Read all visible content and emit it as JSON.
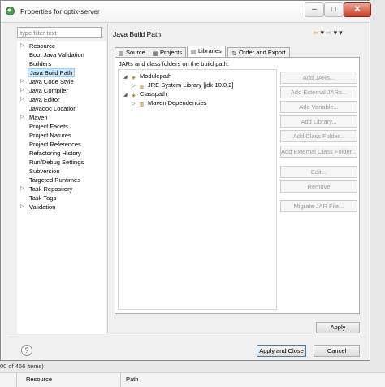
{
  "window": {
    "title": "Properties for optix-server",
    "minimize_glyph": "–",
    "maximize_glyph": "□",
    "close_glyph": "✕"
  },
  "filter": {
    "placeholder": "type filter text"
  },
  "left_tree": [
    {
      "label": "Resource",
      "arrow": "▷"
    },
    {
      "label": "Boot Java Validation",
      "arrow": ""
    },
    {
      "label": "Builders",
      "arrow": ""
    },
    {
      "label": "Java Build Path",
      "arrow": "",
      "selected": true
    },
    {
      "label": "Java Code Style",
      "arrow": "▷"
    },
    {
      "label": "Java Compiler",
      "arrow": "▷"
    },
    {
      "label": "Java Editor",
      "arrow": "▷"
    },
    {
      "label": "Javadoc Location",
      "arrow": ""
    },
    {
      "label": "Maven",
      "arrow": "▷"
    },
    {
      "label": "Project Facets",
      "arrow": ""
    },
    {
      "label": "Project Natures",
      "arrow": ""
    },
    {
      "label": "Project References",
      "arrow": ""
    },
    {
      "label": "Refactoring History",
      "arrow": ""
    },
    {
      "label": "Run/Debug Settings",
      "arrow": ""
    },
    {
      "label": "Subversion",
      "arrow": ""
    },
    {
      "label": "Targeted Runtimes",
      "arrow": ""
    },
    {
      "label": "Task Repository",
      "arrow": "▷"
    },
    {
      "label": "Task Tags",
      "arrow": ""
    },
    {
      "label": "Validation",
      "arrow": "▷"
    }
  ],
  "page": {
    "title": "Java Build Path",
    "nav": {
      "back": "⇦",
      "back_menu": "▾",
      "forward": "⇨",
      "forward_menu": "▾",
      "view_menu": "▾"
    }
  },
  "tabs": [
    {
      "label": "Source",
      "icon": "▤"
    },
    {
      "label": "Projects",
      "icon": "▦"
    },
    {
      "label": "Libraries",
      "icon": "▥",
      "active": true
    },
    {
      "label": "Order and Export",
      "icon": "⇅"
    }
  ],
  "panel": {
    "label": "JARs and class folders on the build path:",
    "tree": [
      {
        "label": "Modulepath",
        "arrow": "◢",
        "icon": "◈",
        "level": 0
      },
      {
        "label": "JRE System Library [jdk-10.0.2]",
        "arrow": "▷",
        "icon": "▥",
        "level": 1
      },
      {
        "label": "Classpath",
        "arrow": "◢",
        "icon": "◈",
        "level": 0
      },
      {
        "label": "Maven Dependencies",
        "arrow": "▷",
        "icon": "▥",
        "level": 1
      }
    ],
    "buttons": [
      "Add JARs...",
      "Add External JARs...",
      "Add Variable...",
      "Add Library...",
      "Add Class Folder...",
      "Add External Class Folder...",
      "Edit...",
      "Remove",
      "Migrate JAR File..."
    ]
  },
  "footer": {
    "apply_label": "Apply",
    "apply_close_label": "Apply and Close",
    "cancel_label": "Cancel",
    "help_glyph": "?"
  },
  "background": {
    "status_text": "00 of 466 items)",
    "col_resource": "Resource",
    "col_path": "Path"
  }
}
